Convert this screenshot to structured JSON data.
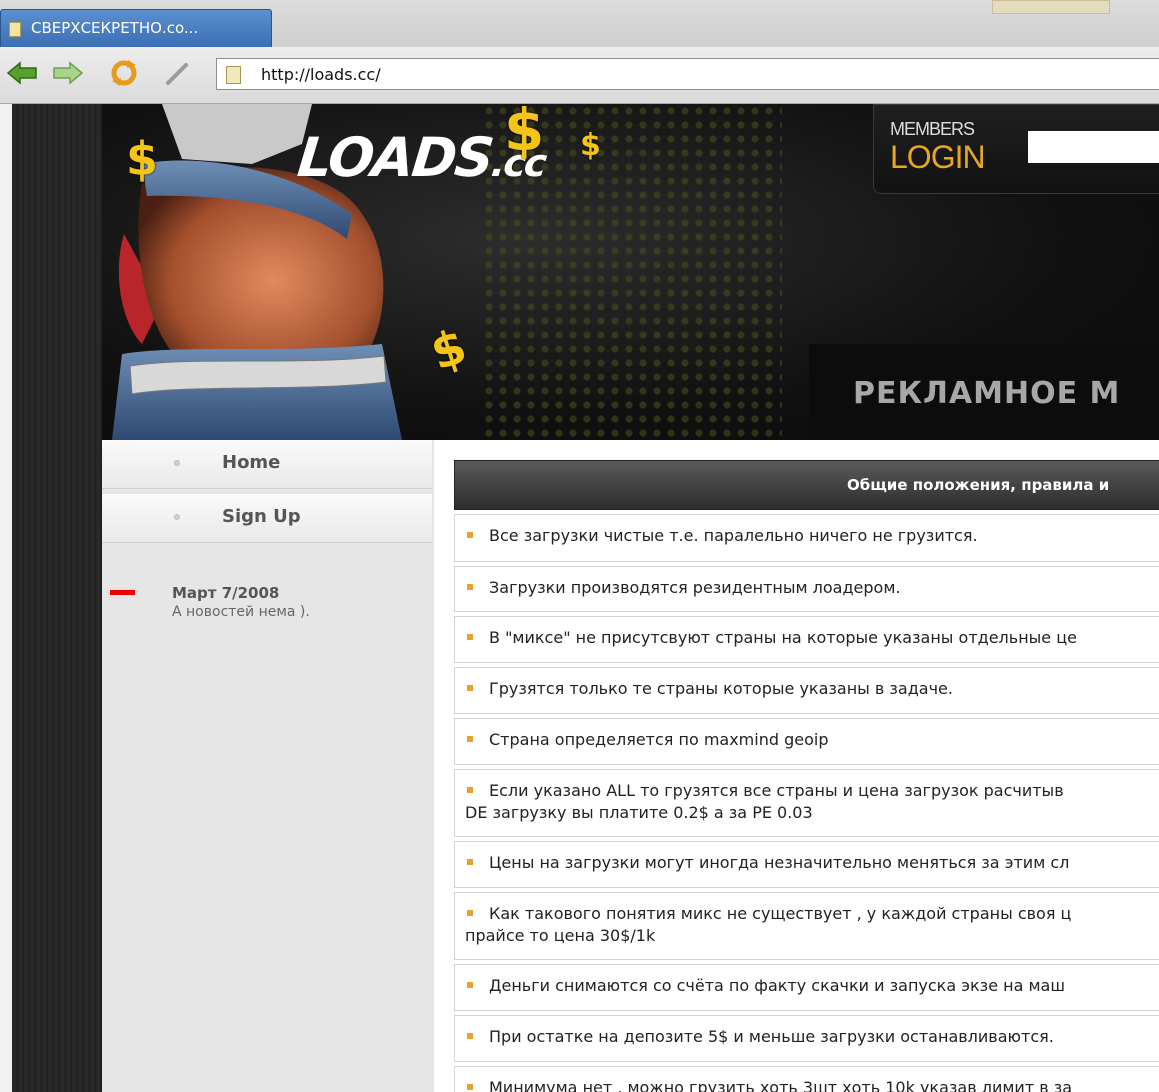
{
  "browser": {
    "tab_title": "СВЕРХСЕКРЕТНО.co...",
    "url": "http://loads.cc/",
    "icons": [
      "back-arrow-icon",
      "forward-arrow-icon",
      "reload-icon",
      "edit-icon",
      "page-icon"
    ]
  },
  "header": {
    "logo_main": "LOADS",
    "logo_suffix": ".cc",
    "dollar_sign": "$",
    "members_label": "MEMBERS",
    "login_label": "LOGIN",
    "login_input_value": "",
    "ad_text": "РЕКЛАМНОЕ М"
  },
  "sidebar": {
    "items": [
      {
        "label": "Home"
      },
      {
        "label": "Sign Up"
      }
    ],
    "news": {
      "date": "Март 7/2008",
      "text": "А новостей нема )."
    }
  },
  "content": {
    "title": "Общие положения, правила и",
    "rules": [
      "Все загрузки чистые т.е. паралельно ничего не грузится.",
      "Загрузки производятся резидентным лоадером.",
      "В \"миксе\" не присутсвуют страны на которые указаны отдельные це",
      "Грузятся только те страны которые указаны в задаче.",
      "Страна определяется по maxmind geoip",
      "Если указано ALL то грузятся все страны и цена загрузок расчитыв",
      "DE загрузку вы платите 0.2$ а за PE 0.03",
      "Цены на загрузки могут иногда незначительно меняться за этим сл",
      "Как такового понятия микс не существует , у каждой страны своя ц",
      "прайсе то цена 30$/1k",
      "Деньги снимаются со счёта по факту скачки и запуска экзе на маш",
      "При остатке на депозите 5$ и меньше загрузки останавливаются.",
      "Минимума нет , можно грузить хоть 3шт хоть 10k указав лимит в за"
    ]
  },
  "colors": {
    "tab_blue": "#3c6fb4",
    "gold": "#f4c416",
    "login_orange": "#e6a820",
    "rule_bullet": "#e8a030",
    "news_marker": "#ee0000"
  }
}
